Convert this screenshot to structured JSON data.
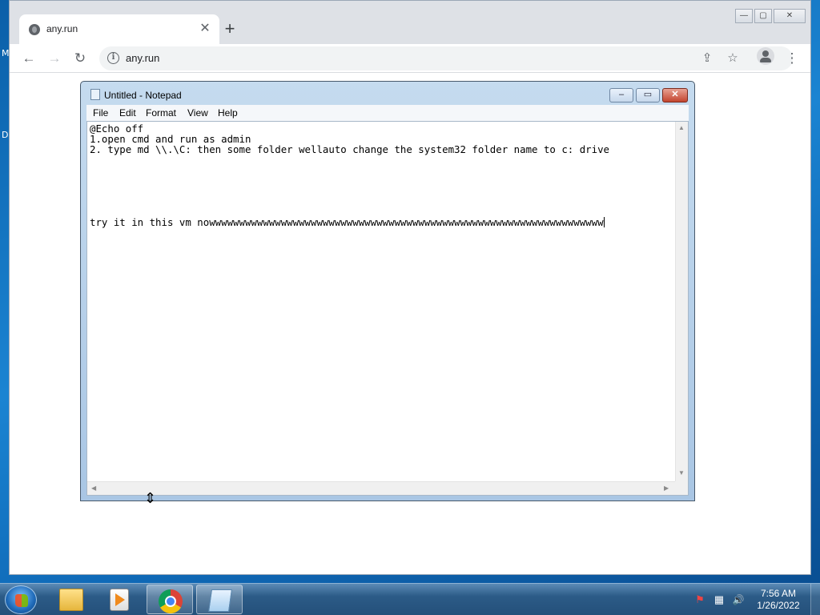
{
  "browser": {
    "tab": {
      "title": "any.run",
      "close_glyph": "✕"
    },
    "new_tab_glyph": "+",
    "window_controls": {
      "minimize": "—",
      "maximize": "▢",
      "close": "✕"
    },
    "nav": {
      "back": "←",
      "forward": "→",
      "reload": "↻"
    },
    "address": {
      "info_glyph": "i",
      "url": "any.run"
    },
    "actions": {
      "share": "⇪",
      "bookmark": "☆",
      "menu": "⋮"
    }
  },
  "desktop_fragments": [
    "M",
    "D"
  ],
  "notepad": {
    "title": "Untitled - Notepad",
    "controls": {
      "minimize": "–",
      "maximize": "▭",
      "close": "✕"
    },
    "menu": [
      "File",
      "Edit",
      "Format",
      "View",
      "Help"
    ],
    "lines": [
      "@Echo off",
      "1.open cmd and run as admin",
      "2. type md \\\\.\\C: then some folder wellauto change the system32 folder name to c: drive",
      "",
      "",
      "",
      "",
      "",
      "",
      "try it in this vm nowwwwwwwwwwwwwwwwwwwwwwwwwwwwwwwwwwwwwwwwwwwwwwwwwwwwwwwwwwwwwwwwww"
    ],
    "scroll_glyphs": {
      "up": "▲",
      "down": "▼",
      "left": "◀",
      "right": "▶"
    }
  },
  "taskbar": {
    "items": [
      {
        "name": "folder",
        "active": false
      },
      {
        "name": "media-player",
        "active": false
      },
      {
        "name": "chrome",
        "active": true
      },
      {
        "name": "notepad",
        "active": true
      }
    ],
    "tray": {
      "flag_glyph": "⚑",
      "network_glyph": "▦",
      "volume_glyph": "🔊"
    },
    "clock": {
      "time": "7:56 AM",
      "date": "1/26/2022"
    }
  },
  "colors": {
    "desktop": "#1b84d2",
    "chrome_titlebar": "#dee1e6",
    "notepad_frame": "#c5dbef",
    "taskbar": "#2c5b87"
  }
}
